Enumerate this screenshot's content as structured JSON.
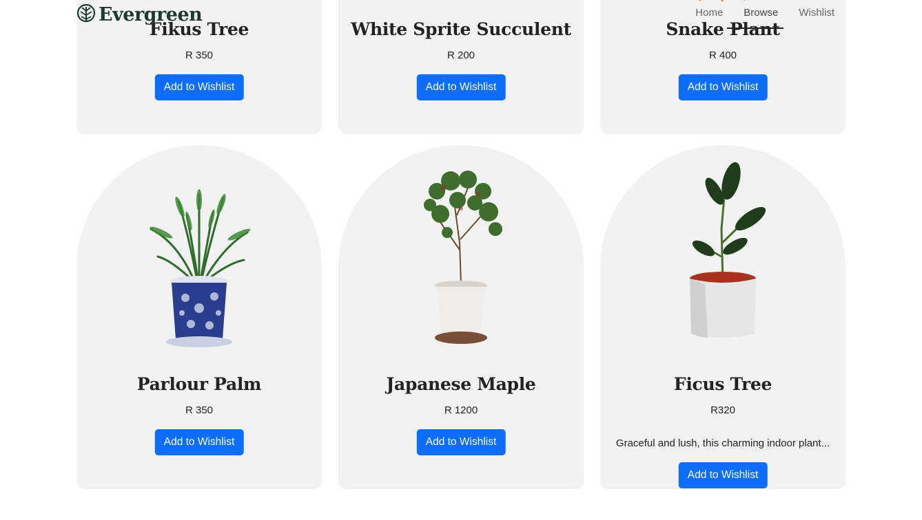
{
  "header": {
    "logo_text": "Evergreen",
    "nav": [
      {
        "label": "Home"
      },
      {
        "label": "Browse"
      },
      {
        "label": "Wishlist"
      }
    ]
  },
  "products_top": [
    {
      "name": "Fikus Tree",
      "price": "R 350",
      "button": "Add to Wishlist"
    },
    {
      "name": "White Sprite Succulent",
      "price": "R 200",
      "button": "Add to Wishlist"
    },
    {
      "name": "Snake Plant",
      "price": "R 400",
      "button": "Add to Wishlist"
    }
  ],
  "products_bottom": [
    {
      "name": "Parlour Palm",
      "price": "R 350",
      "button": "Add to Wishlist",
      "image": "palm-plant-icon"
    },
    {
      "name": "Japanese Maple",
      "price": "R 1200",
      "button": "Add to Wishlist",
      "image": "maple-plant-icon"
    },
    {
      "name": "Ficus Tree",
      "price": "R320",
      "description": "Graceful and lush, this charming indoor plant...",
      "button": "Add to Wishlist",
      "image": "ficus-plant-icon"
    }
  ],
  "colors": {
    "accent": "#0d6efd",
    "card_bg": "#f2f2f2",
    "brand": "#1e3a2f"
  }
}
